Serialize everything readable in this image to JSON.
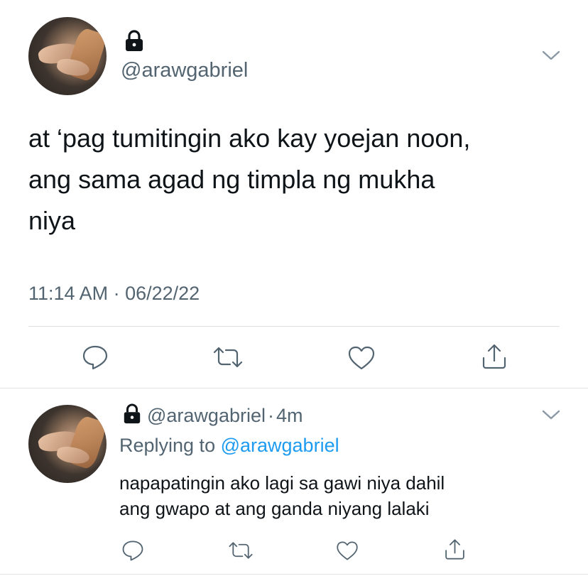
{
  "main_tweet": {
    "handle": "@arawgabriel",
    "text_lines": [
      "at ‘pag tumitingin ako kay yoejan noon,",
      "ang sama agad ng timpla ng mukha",
      "niya"
    ],
    "time": "11:14 AM",
    "separator": " · ",
    "date": "06/22/22"
  },
  "reply_tweet": {
    "handle": "@arawgabriel",
    "dot": "·",
    "age": "4m",
    "replying_prefix": "Replying to ",
    "replying_to": "@arawgabriel",
    "text_lines": [
      "napapatingin ako lagi sa gawi niya dahil",
      "ang gwapo at ang ganda niyang lalaki"
    ]
  },
  "icons": {
    "lock": "lock-icon",
    "chevron": "chevron-down-icon",
    "reply": "reply-icon",
    "retweet": "retweet-icon",
    "like": "heart-icon",
    "share": "share-icon"
  },
  "colors": {
    "text": "#0f1419",
    "secondary": "#536471",
    "link": "#1d9bf0",
    "divider": "#dfe3e6"
  }
}
